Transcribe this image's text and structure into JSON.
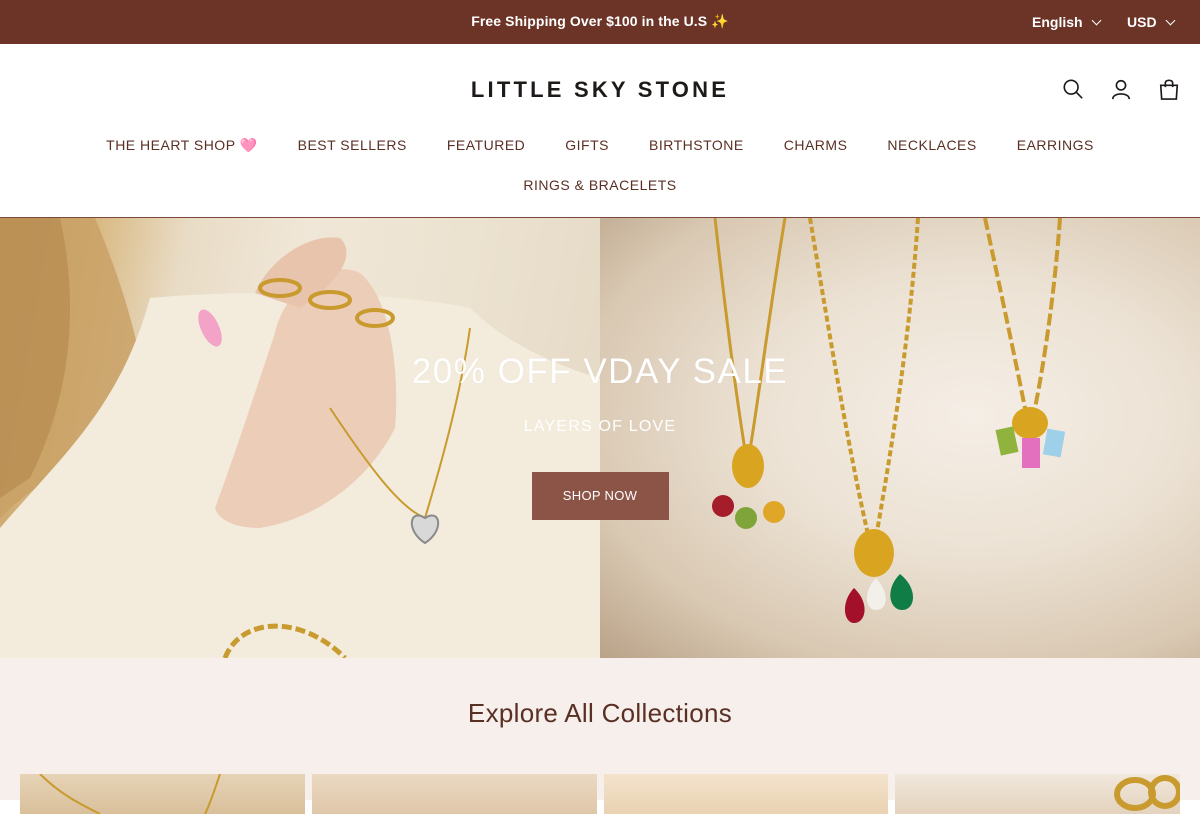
{
  "announcement": {
    "text": "Free Shipping Over $100 in the U.S ✨"
  },
  "language_selector": {
    "value": "English"
  },
  "currency_selector": {
    "value": "USD"
  },
  "header": {
    "logo": "LITTLE SKY STONE",
    "icons": [
      "search-icon",
      "account-icon",
      "cart-icon"
    ]
  },
  "nav": {
    "row1": [
      "THE HEART SHOP 🩷",
      "BEST SELLERS",
      "FEATURED",
      "GIFTS",
      "BIRTHSTONE",
      "CHARMS",
      "NECKLACES",
      "EARRINGS"
    ],
    "row2": [
      "RINGS & BRACELETS"
    ]
  },
  "hero": {
    "title": "20% OFF VDAY SALE",
    "subtitle": "LAYERS OF LOVE",
    "button": "SHOP NOW"
  },
  "collections": {
    "title": "Explore All Collections"
  },
  "colors": {
    "topbar": "#6c3427",
    "button": "#8b5446",
    "text": "#5a2f24",
    "section_bg": "#f6efeb"
  }
}
